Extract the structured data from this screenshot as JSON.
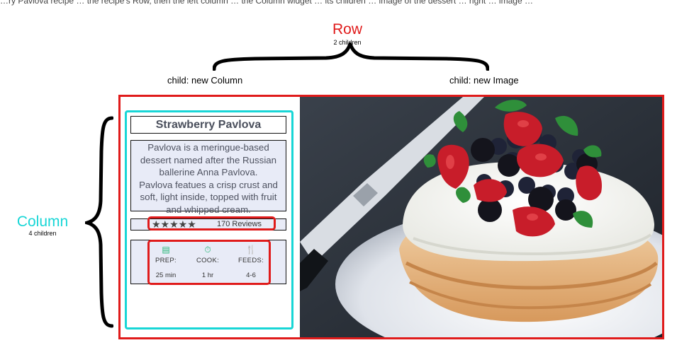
{
  "top_caption": "…ry Pavlova recipe … the recipe's Row, then the left column … the Column widget … its children … image of the dessert … right … image …",
  "row": {
    "title": "Row",
    "subtitle": "2 children"
  },
  "row_children": {
    "left": "child: new Column",
    "right": "child: new Image"
  },
  "column": {
    "title": "Column",
    "subtitle": "4 children"
  },
  "card": {
    "title": "Strawberry Pavlova",
    "description_lines": [
      "Pavlova is a meringue-based",
      "dessert named after the Russian",
      "ballerine Anna Pavlova.",
      "Pavlova featues a crisp crust and",
      "soft, light inside, topped with fruit",
      "and whipped cream."
    ],
    "rating_stars": "★★★★★",
    "reviews": "170 Reviews",
    "info": [
      {
        "icon": "recipe-book-icon",
        "glyph": "▤",
        "label": "PREP:",
        "value": "25 min"
      },
      {
        "icon": "timer-icon",
        "glyph": "⏱",
        "label": "COOK:",
        "value": "1 hr"
      },
      {
        "icon": "utensils-icon",
        "glyph": "🍴",
        "label": "FEEDS:",
        "value": "4-6"
      }
    ]
  },
  "colors": {
    "row_accent": "#e01b1b",
    "column_accent": "#18d6d6",
    "icon_green": "#22b573",
    "card_bg": "#e8ebf7"
  }
}
